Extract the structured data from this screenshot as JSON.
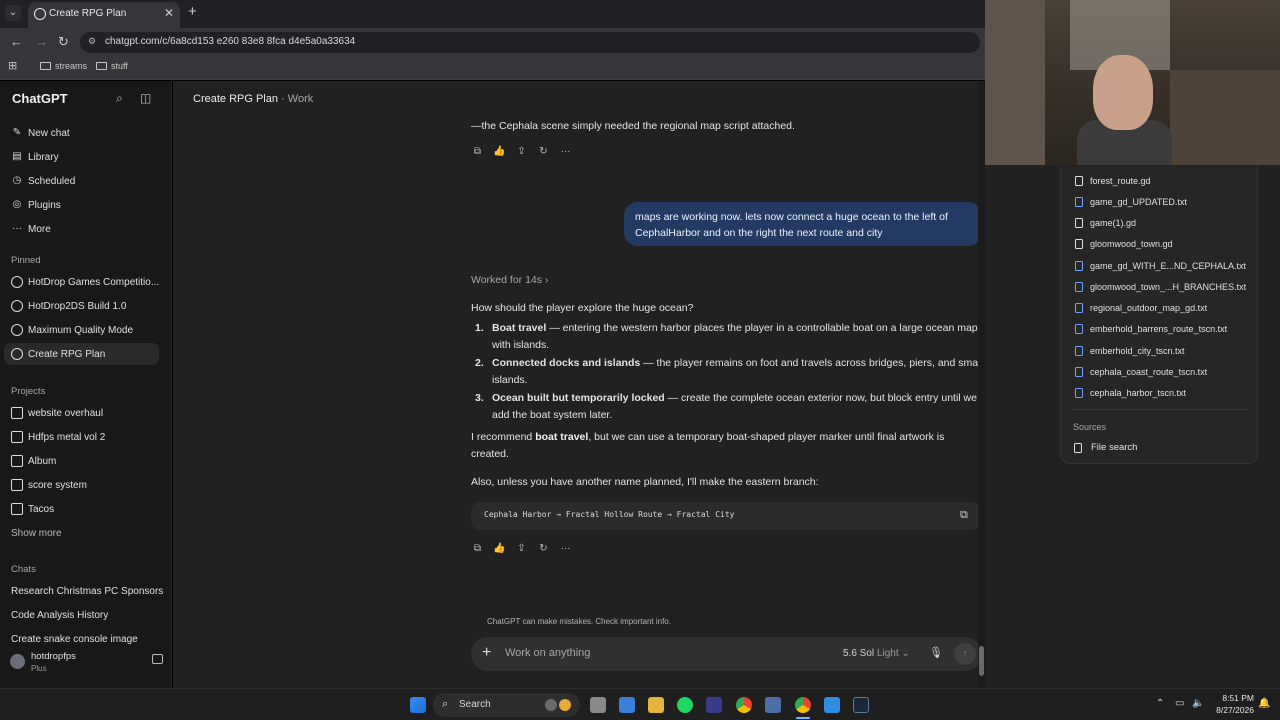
{
  "browser": {
    "tab_title": "Create RPG Plan",
    "url": "chatgpt.com/c/6a8cd153 e260 83e8 8fca d4e5a0a33634",
    "bookmarks": [
      "streams",
      "stuff"
    ]
  },
  "sidebar": {
    "brand": "ChatGPT",
    "nav": [
      {
        "label": "New chat",
        "icon": "new-chat-icon"
      },
      {
        "label": "Library",
        "icon": "library-icon"
      },
      {
        "label": "Scheduled",
        "icon": "clock-icon"
      },
      {
        "label": "Plugins",
        "icon": "plugins-icon"
      },
      {
        "label": "More",
        "icon": "more-icon"
      }
    ],
    "pinned_label": "Pinned",
    "pinned": [
      "HotDrop Games Competitio...",
      "HotDrop2DS Build 1.0",
      "Maximum Quality Mode",
      "Create RPG Plan"
    ],
    "projects_label": "Projects",
    "projects": [
      "website overhaul",
      "Hdfps metal vol 2",
      "Album",
      "score system",
      "Tacos"
    ],
    "show_more": "Show more",
    "chats_label": "Chats",
    "chats": [
      "Research Christmas PC Sponsors",
      "Code Analysis History",
      "Create snake console image"
    ],
    "user": {
      "name": "hotdropfps",
      "plan": "Plus"
    }
  },
  "main": {
    "title": "Create RPG Plan",
    "project": "Work",
    "prev_line": "—the Cephala scene simply needed the regional map script attached.",
    "user_message": "maps are working now. lets now connect a huge ocean to the left of CephalHarbor and on the right the next route and city",
    "worked_for": "Worked for 14s",
    "question": "How should the player explore the huge ocean?",
    "options": [
      {
        "num": "1.",
        "title": "Boat travel",
        "text": " — entering the western harbor places the player in a controllable boat on a large ocean map with islands."
      },
      {
        "num": "2.",
        "title": "Connected docks and islands",
        "text": " — the player remains on foot and travels across bridges, piers, and small islands."
      },
      {
        "num": "3.",
        "title": "Ocean built but temporarily locked",
        "text": " — create the complete ocean exterior now, but block entry until we add the boat system later."
      }
    ],
    "recommend_pre": "I recommend ",
    "recommend_bold": "boat travel",
    "recommend_post": ", but we can use a temporary boat-shaped player marker until final artwork is created.",
    "also_line": "Also, unless you have another name planned, I'll make the eastern branch:",
    "code": "Cephala Harbor → Fractal Hollow Route → Fractal City",
    "disclaimer": "ChatGPT can make mistakes. Check important info.",
    "composer_placeholder": "Work on anything",
    "model": "5.6 Sol",
    "model_mode": "Light"
  },
  "files_panel": {
    "files": [
      {
        "name": "forest_route.gd",
        "blue": false
      },
      {
        "name": "game_gd_UPDATED.txt",
        "blue": true
      },
      {
        "name": "game(1).gd",
        "blue": false
      },
      {
        "name": "gloomwood_town.gd",
        "blue": false
      },
      {
        "name": "game_gd_WITH_E...ND_CEPHALA.txt",
        "blue": true
      },
      {
        "name": "gloomwood_town_...H_BRANCHES.txt",
        "blue": true
      },
      {
        "name": "regional_outdoor_map_gd.txt",
        "blue": true
      },
      {
        "name": "emberhold_barrens_route_tscn.txt",
        "blue": true
      },
      {
        "name": "emberhold_city_tscn.txt",
        "blue": true
      },
      {
        "name": "cephala_coast_route_tscn.txt",
        "blue": true
      },
      {
        "name": "cephala_harbor_tscn.txt",
        "blue": true
      }
    ],
    "sources_label": "Sources",
    "file_search": "File search"
  },
  "taskbar": {
    "search": "Search",
    "time": "8:51 PM",
    "date": "8/27/2026"
  }
}
